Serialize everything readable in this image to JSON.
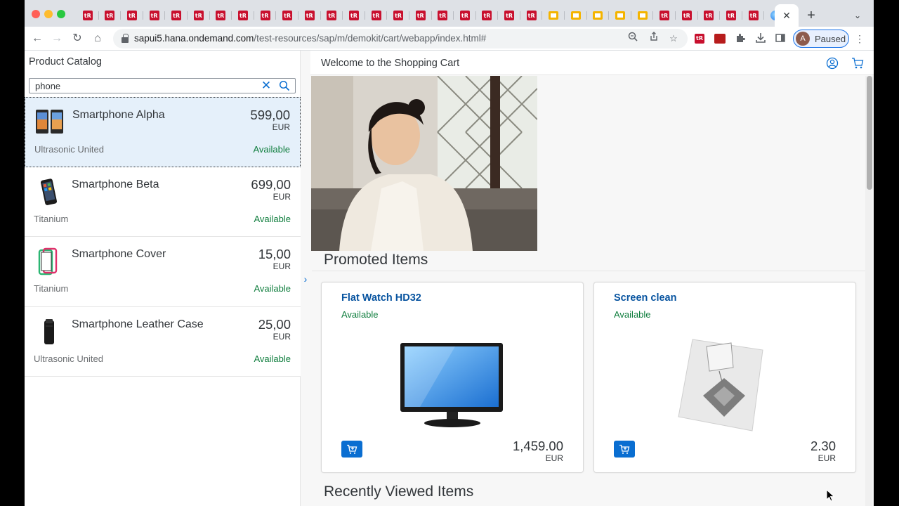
{
  "browser": {
    "tab_count_tr": 21,
    "active_tab_close": "✕",
    "new_tab": "+",
    "url_host": "sapui5.hana.ondemand.com",
    "url_path": "/test-resources/sap/m/demokit/cart/webapp/index.html#",
    "profile_initial": "A",
    "profile_status": "Paused"
  },
  "master": {
    "title": "Product Catalog",
    "search_value": "phone",
    "products": [
      {
        "name": "Smartphone Alpha",
        "price": "599,00",
        "currency": "EUR",
        "supplier": "Ultrasonic United",
        "status": "Available"
      },
      {
        "name": "Smartphone Beta",
        "price": "699,00",
        "currency": "EUR",
        "supplier": "Titanium",
        "status": "Available"
      },
      {
        "name": "Smartphone Cover",
        "price": "15,00",
        "currency": "EUR",
        "supplier": "Titanium",
        "status": "Available"
      },
      {
        "name": "Smartphone Leather Case",
        "price": "25,00",
        "currency": "EUR",
        "supplier": "Ultrasonic United",
        "status": "Available"
      }
    ]
  },
  "detail": {
    "title": "Welcome to the Shopping Cart",
    "promoted_title": "Promoted Items",
    "recent_title": "Recently Viewed Items",
    "promoted": [
      {
        "name": "Flat Watch HD32",
        "status": "Available",
        "price": "1,459.00",
        "currency": "EUR"
      },
      {
        "name": "Screen clean",
        "status": "Available",
        "price": "2.30",
        "currency": "EUR"
      }
    ]
  },
  "colors": {
    "accent": "#0a6ed1",
    "link": "#0854a0",
    "success": "#107e3e",
    "selected_row": "#e5f0fa"
  }
}
